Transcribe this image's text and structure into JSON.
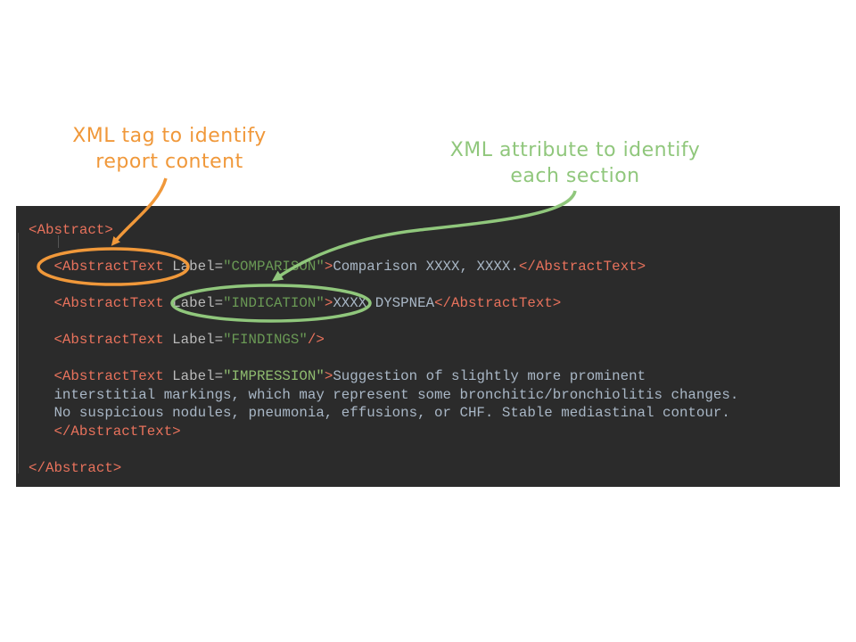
{
  "callouts": {
    "tag_line1": "XML tag to identify",
    "tag_line2": "report content",
    "attr_line1": "XML attribute to identify",
    "attr_line2": "each section"
  },
  "colors": {
    "tag_callout": "#f0983a",
    "attr_callout": "#90c77c",
    "panel_bg": "#2b2b2b"
  },
  "code": {
    "open_abstract": "<Abstract>",
    "close_abstract": "</Abstract>",
    "tag_open": "<AbstractText",
    "tag_close": "</AbstractText>",
    "label_attr": " Label=",
    "selfclose": "/>",
    "gt": ">",
    "comparison_label": "\"COMPARISON\"",
    "comparison_text": "Comparison XXXX, XXXX.",
    "indication_label": "\"INDICATION\"",
    "indication_text": "XXXX DYSPNEA",
    "findings_label": "\"FINDINGS\"",
    "impression_label": "\"IMPRESSION\"",
    "impression_text_1": "Suggestion of slightly more prominent",
    "impression_text_2": "interstitial markings, which may represent some bronchitic/bronchiolitis changes.",
    "impression_text_3": "No suspicious nodules, pneumonia, effusions, or CHF. Stable mediastinal contour."
  }
}
